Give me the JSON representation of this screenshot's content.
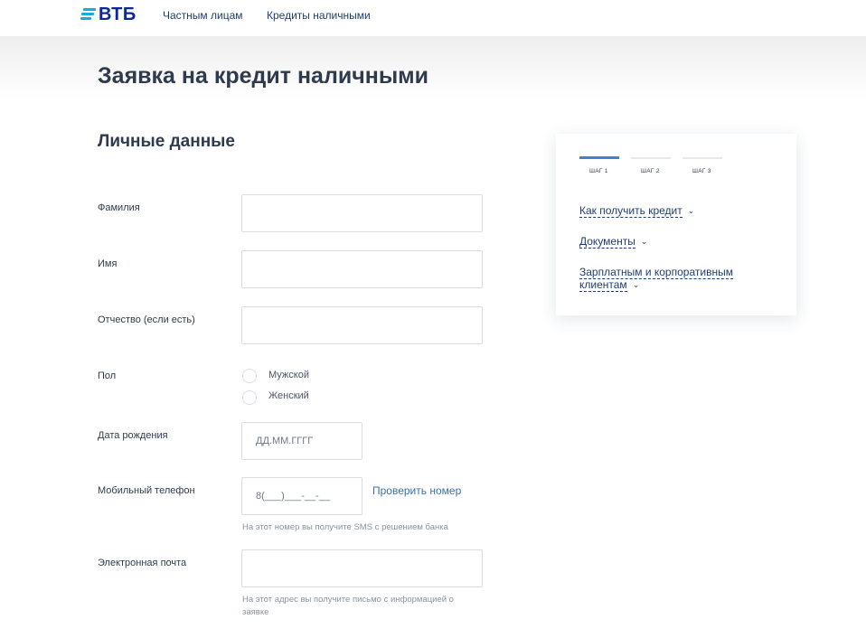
{
  "header": {
    "logo_text": "ВТБ",
    "nav": [
      "Частным лицам",
      "Кредиты наличными"
    ]
  },
  "page_title": "Заявка на кредит наличными",
  "section_title": "Личные данные",
  "form": {
    "surname_label": "Фамилия",
    "surname_value": "",
    "name_label": "Имя",
    "name_value": "",
    "patronymic_label": "Отчество (если есть)",
    "patronymic_value": "",
    "gender_label": "Пол",
    "gender_options": [
      "Мужской",
      "Женский"
    ],
    "gender_selected": "",
    "birthdate_label": "Дата рождения",
    "birthdate_placeholder": "ДД.ММ.ГГГГ",
    "phone_label": "Мобильный телефон",
    "phone_placeholder": "8(___)___-__-__",
    "check_number_link": "Проверить номер",
    "phone_hint": "На этот номер вы получите SMS с решением банка",
    "email_label": "Электронная почта",
    "email_value": "",
    "email_hint": "На этот адрес вы получите письмо с информацией о заявке"
  },
  "sidebar": {
    "steps": [
      "ШАГ 1",
      "ШАГ 2",
      "ШАГ 3"
    ],
    "active_step": 1,
    "links": [
      "Как получить кредит",
      "Документы",
      "Зарплатным и корпоративным клиентам"
    ],
    "accent_color": "#3b82d6"
  }
}
